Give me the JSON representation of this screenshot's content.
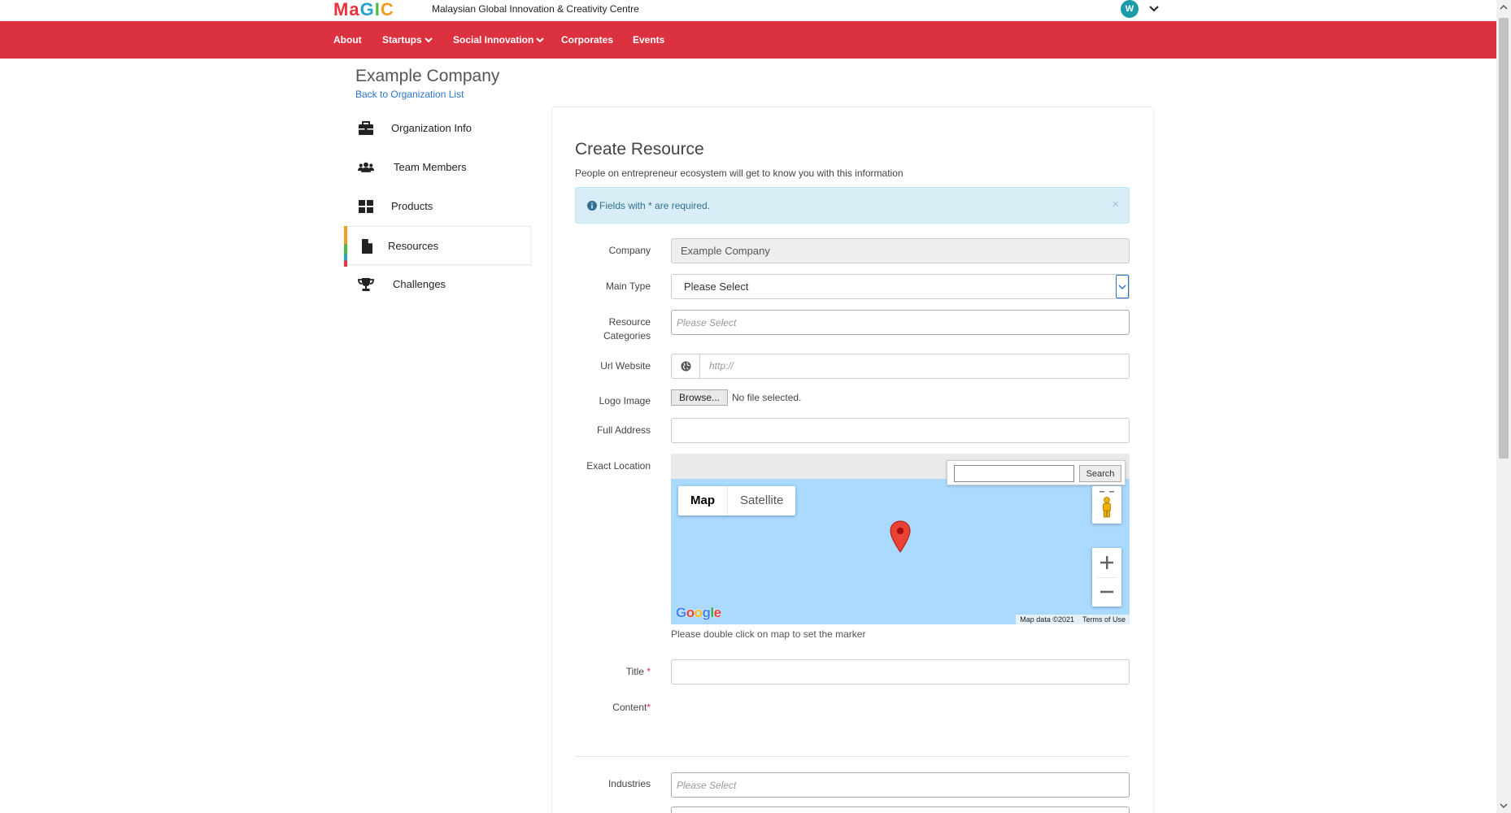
{
  "header": {
    "logo": [
      "Ma",
      "G",
      "I",
      "C"
    ],
    "brand_text": "Malaysian Global Innovation & Creativity Centre",
    "avatar_letter": "W"
  },
  "nav": {
    "items": [
      {
        "label": "About",
        "dropdown": false
      },
      {
        "label": "Startups",
        "dropdown": true
      },
      {
        "label": "Social Innovation",
        "dropdown": true
      },
      {
        "label": "Corporates",
        "dropdown": false
      },
      {
        "label": "Events",
        "dropdown": false
      }
    ]
  },
  "page": {
    "company_title": "Example Company",
    "back_link": "Back to Organization List"
  },
  "sidebar": {
    "items": [
      {
        "label": "Organization Info",
        "icon": "briefcase-icon"
      },
      {
        "label": "Team Members",
        "icon": "users-icon"
      },
      {
        "label": "Products",
        "icon": "grid-icon"
      },
      {
        "label": "Resources",
        "icon": "file-icon",
        "active": true
      },
      {
        "label": "Challenges",
        "icon": "trophy-icon"
      }
    ]
  },
  "form": {
    "title": "Create Resource",
    "subtitle": "People on entrepreneur ecosystem will get to know you with this information",
    "alert": "Fields with * are required.",
    "alert_close": "×",
    "required_mark": "*",
    "labels": {
      "company": "Company",
      "main_type": "Main Type",
      "resource_categories_1": "Resource",
      "resource_categories_2": "Categories",
      "url_website": "Url Website",
      "logo_image": "Logo Image",
      "full_address": "Full Address",
      "exact_location": "Exact Location",
      "title": "Title",
      "content": "Content",
      "industries": "Industries"
    },
    "values": {
      "company": "Example Company",
      "main_type": "Please Select",
      "resource_categories_placeholder": "Please Select",
      "url_placeholder": "http://",
      "browse_button": "Browse...",
      "file_status": "No file selected.",
      "industries_placeholder": "Please Select"
    },
    "map": {
      "search_button": "Search",
      "type_map": "Map",
      "type_satellite": "Satellite",
      "attribution_data": "Map data ©2021",
      "attribution_terms": "Terms of Use",
      "hint": "Please double click on map to set the marker",
      "google_letters": [
        "G",
        "o",
        "o",
        "g",
        "l",
        "e"
      ]
    }
  },
  "colors": {
    "nav_red": "#dc313f",
    "link_blue": "#2a74c9",
    "alert_bg": "#d9edf7",
    "map_water": "#aadaff",
    "marker_red": "#ea4335"
  }
}
